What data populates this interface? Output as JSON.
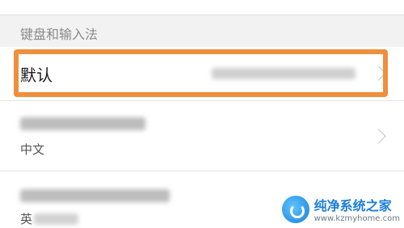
{
  "section": {
    "title": "键盘和输入法"
  },
  "rows": [
    {
      "label": "默认",
      "value": ""
    },
    {
      "label": "",
      "subtitle": "中文"
    },
    {
      "label": "",
      "subtitle": "英"
    }
  ],
  "watermark": {
    "title": "纯净系统之家",
    "url": "www.kzmyhome.com"
  },
  "colors": {
    "highlight": "#ef8f3c",
    "section_bg": "#f2f2f2"
  }
}
